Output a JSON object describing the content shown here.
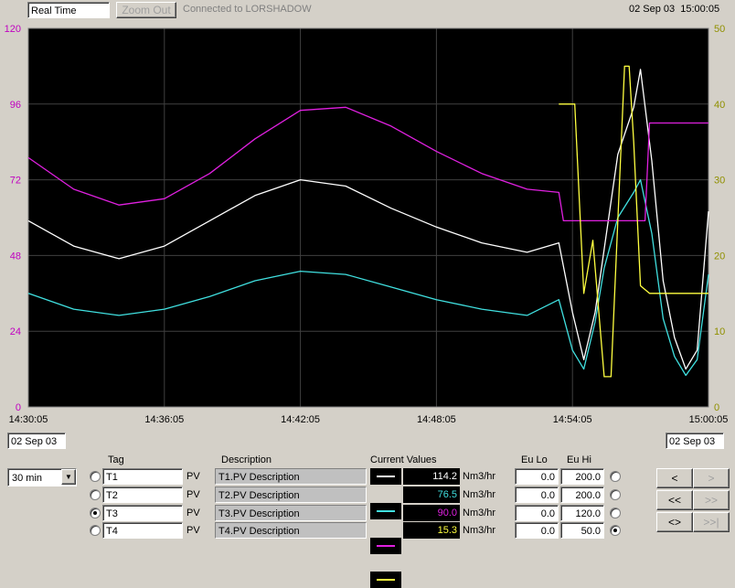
{
  "toolbar": {
    "mode": "Real Time",
    "zoom_out": "Zoom Out",
    "connection": "Connected to LORSHADOW",
    "timestamp": "02 Sep 03  15:00:05"
  },
  "colors": {
    "T1": "#ffffff",
    "T2": "#40e0e0",
    "T3": "#e020e0",
    "T4": "#ffff40"
  },
  "chart_data": {
    "type": "line",
    "x_ticks": [
      "14:30:05",
      "14:36:05",
      "14:42:05",
      "14:48:05",
      "14:54:05",
      "15:00:05"
    ],
    "x_range": [
      "14:30:05",
      "15:00:05"
    ],
    "y_left_ticks": [
      "120",
      "96",
      "72",
      "48",
      "24",
      "0"
    ],
    "y_left_range": [
      0,
      120
    ],
    "y_right_ticks": [
      "50",
      "40",
      "30",
      "20",
      "10",
      "0"
    ],
    "y_right_range": [
      0,
      50
    ],
    "grid": true,
    "series": [
      {
        "name": "T1",
        "axis": "left",
        "color": "#ffffff",
        "t": [
          0,
          2,
          4,
          6,
          8,
          10,
          12,
          14,
          16,
          18,
          20,
          22,
          23.4,
          24,
          24.5,
          25,
          25.4,
          26,
          26.7,
          27,
          27.5,
          28,
          28.5,
          29,
          29.5,
          30
        ],
        "v": [
          59,
          51,
          47,
          51,
          59,
          67,
          72,
          70,
          63,
          57,
          52,
          49,
          52,
          30,
          15,
          30,
          50,
          80,
          95,
          107,
          78,
          40,
          22,
          12,
          18,
          62
        ]
      },
      {
        "name": "T2",
        "axis": "left",
        "color": "#40e0e0",
        "t": [
          0,
          2,
          4,
          6,
          8,
          10,
          12,
          14,
          16,
          18,
          20,
          22,
          23.4,
          24,
          24.5,
          25,
          25.4,
          26,
          26.7,
          27,
          27.5,
          28,
          28.5,
          29,
          29.5,
          30
        ],
        "v": [
          36,
          31,
          29,
          31,
          35,
          40,
          43,
          42,
          38,
          34,
          31,
          29,
          34,
          18,
          12,
          27,
          44,
          60,
          68,
          72,
          55,
          28,
          16,
          10,
          15,
          42
        ]
      },
      {
        "name": "T3",
        "axis": "left",
        "color": "#e020e0",
        "t": [
          0,
          2,
          4,
          6,
          8,
          10,
          12,
          14,
          16,
          18,
          20,
          22,
          23.4,
          23.6,
          26.5,
          27.2,
          27.4,
          27.5,
          30
        ],
        "v": [
          79,
          69,
          64,
          66,
          74,
          85,
          94,
          95,
          89,
          81,
          74,
          69,
          68,
          59,
          59,
          59,
          90,
          90,
          90
        ]
      },
      {
        "name": "T4",
        "axis": "right",
        "color": "#ffff40",
        "t": [
          23.4,
          24.1,
          24.5,
          24.9,
          25.4,
          25.7,
          26.3,
          26.5,
          26.7,
          27.0,
          27.4,
          28.5,
          30
        ],
        "v": [
          40,
          40,
          15,
          22,
          4,
          4,
          45,
          45,
          35,
          16,
          15,
          15,
          15
        ]
      }
    ]
  },
  "dates": {
    "start": "02 Sep 03",
    "end": "02 Sep 03"
  },
  "range_select": {
    "value": "30 min"
  },
  "table": {
    "headers": {
      "tag": "Tag",
      "description": "Description",
      "current": "Current Values",
      "eulo": "Eu Lo",
      "euhi": "Eu Hi"
    },
    "rows": [
      {
        "tag": "T1",
        "pv": "PV",
        "desc": "T1.PV Description",
        "value": "114.2",
        "units": "Nm3/hr",
        "eulo": "0.0",
        "euhi": "200.0",
        "selected": false,
        "axis_selected": false
      },
      {
        "tag": "T2",
        "pv": "PV",
        "desc": "T2.PV Description",
        "value": "76.5",
        "units": "Nm3/hr",
        "eulo": "0.0",
        "euhi": "200.0",
        "selected": false,
        "axis_selected": false
      },
      {
        "tag": "T3",
        "pv": "PV",
        "desc": "T3.PV Description",
        "value": "90.0",
        "units": "Nm3/hr",
        "eulo": "0.0",
        "euhi": "120.0",
        "selected": true,
        "axis_selected": false
      },
      {
        "tag": "T4",
        "pv": "PV",
        "desc": "T4.PV Description",
        "value": "15.3",
        "units": "Nm3/hr",
        "eulo": "0.0",
        "euhi": "50.0",
        "selected": false,
        "axis_selected": true
      }
    ]
  },
  "nav": {
    "back": "<",
    "forward": ">",
    "fast_back": "<<",
    "fast_forward": ">>",
    "expand": "<>",
    "end": ">>|"
  }
}
